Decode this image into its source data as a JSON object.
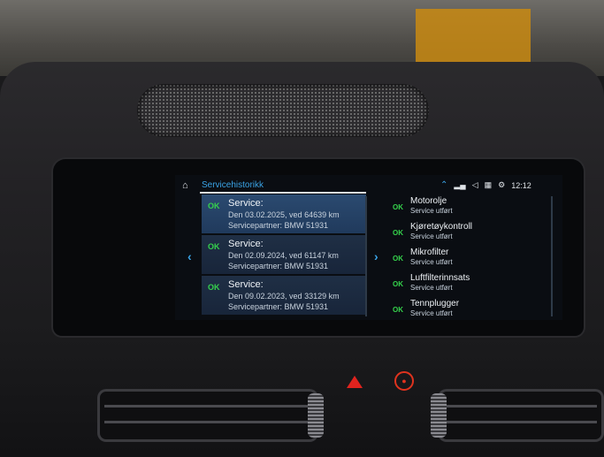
{
  "header": {
    "breadcrumb": "Servicehistorikk",
    "time": "12:12"
  },
  "service_history": [
    {
      "status": "OK",
      "title": "Service:",
      "line1": "Den 03.02.2025, ved 64639 km",
      "line2": "Servicepartner: BMW 51931"
    },
    {
      "status": "OK",
      "title": "Service:",
      "line1": "Den 02.09.2024, ved 61147 km",
      "line2": "Servicepartner: BMW 51931"
    },
    {
      "status": "OK",
      "title": "Service:",
      "line1": "Den 09.02.2023, ved 33129 km",
      "line2": "Servicepartner: BMW 51931"
    }
  ],
  "service_items": [
    {
      "status": "OK",
      "name": "Motorolje",
      "sub": "Service utført"
    },
    {
      "status": "OK",
      "name": "Kjøretøykontroll",
      "sub": "Service utført"
    },
    {
      "status": "OK",
      "name": "Mikrofilter",
      "sub": "Service utført"
    },
    {
      "status": "OK",
      "name": "Luftfilterinnsats",
      "sub": "Service utført"
    },
    {
      "status": "OK",
      "name": "Tennplugger",
      "sub": "Service utført"
    }
  ],
  "colors": {
    "accent": "#3aa3e6",
    "ok": "#35d24c",
    "hazard": "#e0231e"
  },
  "icons": [
    "home-icon",
    "chevron-up-icon",
    "signal-icon",
    "volume-icon",
    "media-icon",
    "settings-icon",
    "chevron-left-icon",
    "chevron-right-icon",
    "hazard-icon",
    "lock-icon"
  ]
}
